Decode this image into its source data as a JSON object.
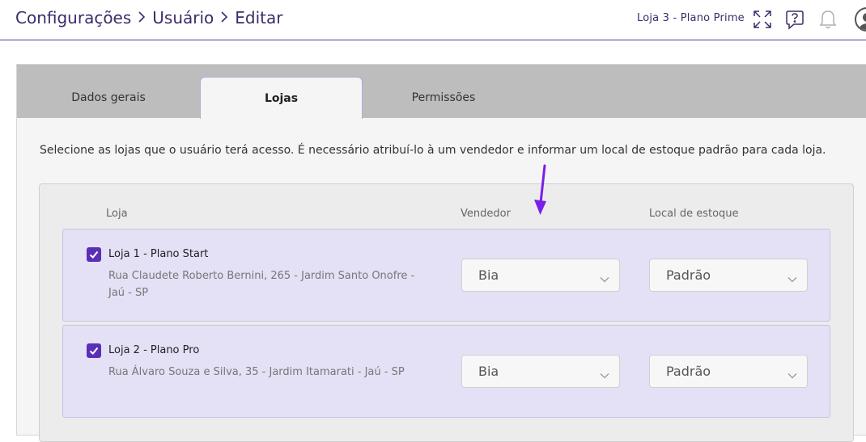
{
  "breadcrumb": {
    "items": [
      "Configurações",
      "Usuário",
      "Editar"
    ],
    "separator": ">"
  },
  "header": {
    "store_label": "Loja 3 - Plano Prime",
    "icons": [
      "expand-icon",
      "help-icon",
      "bell-icon",
      "user-avatar-icon"
    ]
  },
  "tabs": {
    "general": "Dados gerais",
    "stores": "Lojas",
    "permissions": "Permissões",
    "active": "Lojas"
  },
  "description": "Selecione as lojas que o usuário terá acesso. É necessário atribuí-lo à um vendedor e informar um local de estoque padrão para cada loja.",
  "table": {
    "headers": {
      "store": "Loja",
      "seller": "Vendedor",
      "stock": "Local de estoque"
    },
    "rows": [
      {
        "checked": true,
        "name": "Loja 1 - Plano Start",
        "address": "Rua Claudete Roberto Bernini, 265 - Jardim Santo Onofre - Jaú - SP",
        "seller": "Bia",
        "stock": "Padrão"
      },
      {
        "checked": true,
        "name": "Loja 2 - Plano Pro",
        "address": "Rua Álvaro Souza e Silva, 35 - Jardim Itamarati - Jaú - SP",
        "seller": "Bia",
        "stock": "Padrão"
      }
    ]
  },
  "colors": {
    "accent": "#5b2fb5",
    "row_bg": "#e4e0f5",
    "header_text": "#3d2b6b",
    "annotation_arrow": "#7a1fe8"
  }
}
